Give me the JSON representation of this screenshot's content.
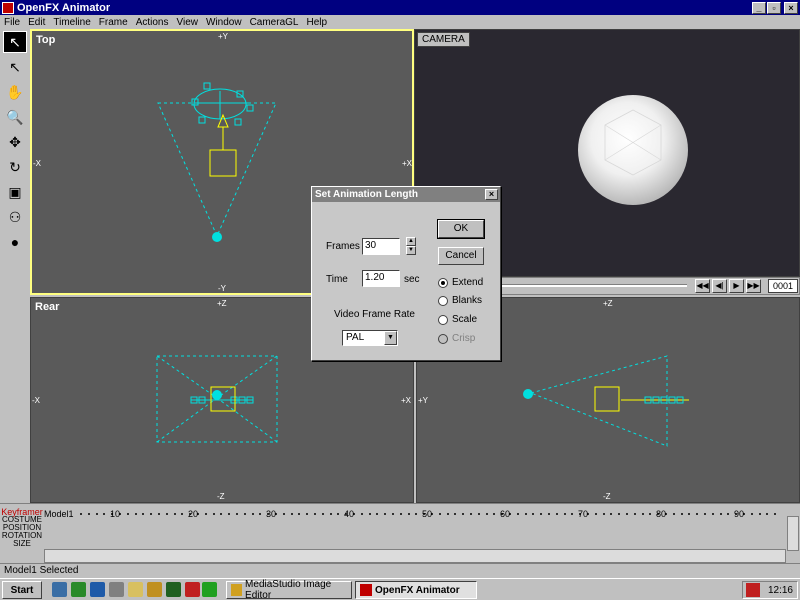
{
  "window": {
    "title": "OpenFX Animator"
  },
  "menu": [
    "File",
    "Edit",
    "Timeline",
    "Frame",
    "Actions",
    "View",
    "Window",
    "CameraGL",
    "Help"
  ],
  "viewports": {
    "top": {
      "label": "Top",
      "axis_top": "+Y",
      "axis_bottom": "-Y",
      "axis_left": "-X",
      "axis_right": "+X"
    },
    "camera": {
      "label": "CAMERA",
      "frame": "0001"
    },
    "rear": {
      "label": "Rear",
      "axis_top": "+Z",
      "axis_bottom": "-Z",
      "axis_left": "-X",
      "axis_right": "+X"
    },
    "side": {
      "axis_top": "+Z",
      "axis_bottom": "-Z",
      "axis_left": "+Y"
    }
  },
  "dialog": {
    "title": "Set Animation Length",
    "frames_label": "Frames",
    "frames_value": "30",
    "time_label": "Time",
    "time_value": "1.20",
    "time_unit": "sec",
    "rate_label": "Video Frame Rate",
    "rate_value": "PAL",
    "ok": "OK",
    "cancel": "Cancel",
    "options": [
      {
        "label": "Extend",
        "selected": true,
        "enabled": true
      },
      {
        "label": "Blanks",
        "selected": false,
        "enabled": true
      },
      {
        "label": "Scale",
        "selected": false,
        "enabled": true
      },
      {
        "label": "Crisp",
        "selected": false,
        "enabled": false
      }
    ]
  },
  "timeline": {
    "keyframer": "Keyframer",
    "rows": [
      "COSTUME",
      "POSITION",
      "ROTATION",
      "SIZE"
    ],
    "model": "Model1",
    "ticks": [
      "10",
      "20",
      "30",
      "40",
      "50",
      "60",
      "70",
      "80",
      "90"
    ]
  },
  "status": {
    "text": "Model1 Selected"
  },
  "taskbar": {
    "start": "Start",
    "tasks": [
      {
        "label": "MediaStudio Image Editor",
        "active": false
      },
      {
        "label": "OpenFX Animator",
        "active": true
      }
    ],
    "clock": "12:16"
  },
  "colors": {
    "wire": "#00e0e0",
    "object": "#ffff00",
    "title": "#000080"
  }
}
